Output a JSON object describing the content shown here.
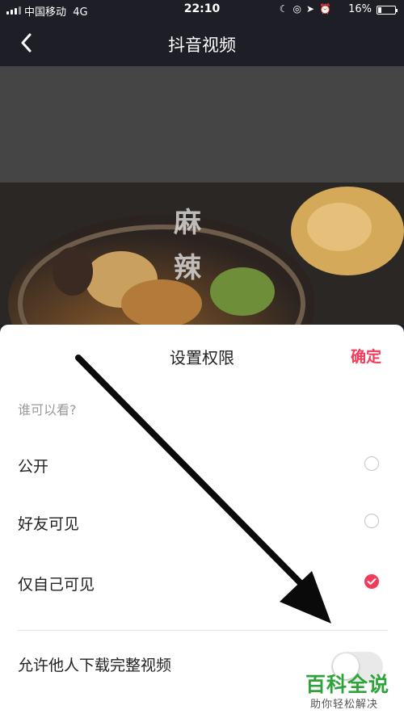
{
  "status_bar": {
    "carrier": "中国移动",
    "network": "4G",
    "time": "22:10",
    "battery_percent": "16%",
    "icons": [
      "moon-icon",
      "rotation-lock-icon",
      "location-icon",
      "alarm-icon"
    ]
  },
  "nav": {
    "title": "抖音视频",
    "back_icon": "chevron-left-icon"
  },
  "video": {
    "overlay_text": "麻辣"
  },
  "sheet": {
    "title": "设置权限",
    "confirm_label": "确定",
    "section_label": "谁可以看?",
    "options": [
      {
        "label": "公开",
        "selected": false
      },
      {
        "label": "好友可见",
        "selected": false
      },
      {
        "label": "仅自己可见",
        "selected": true
      }
    ],
    "download_label": "允许他人下载完整视频",
    "download_enabled": false
  },
  "watermark": {
    "title": "百科全说",
    "subtitle": "助你轻松解决"
  },
  "colors": {
    "accent": "#f23a5a",
    "header_bg": "#1e1e27",
    "watermark_green": "#2fa33a"
  }
}
